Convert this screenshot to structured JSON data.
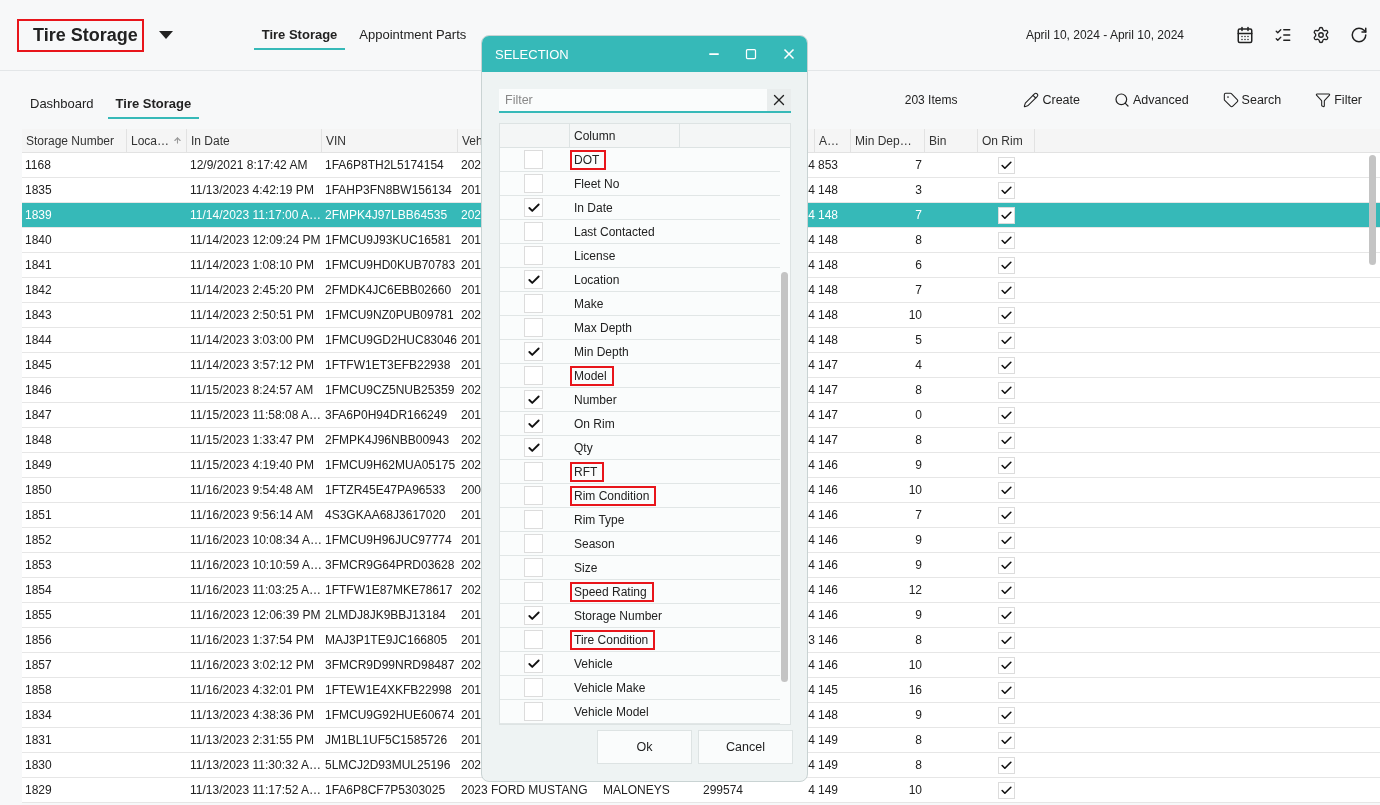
{
  "header": {
    "title": "Tire Storage",
    "title_highlighted": true,
    "nav": [
      {
        "label": "Tire Storage",
        "selected": true
      },
      {
        "label": "Appointment Parts",
        "selected": false
      }
    ],
    "date_range": "April 10, 2024 - April 10, 2024"
  },
  "subnav": {
    "tabs": [
      {
        "label": "Dashboard",
        "selected": false
      },
      {
        "label": "Tire Storage",
        "selected": true
      }
    ],
    "item_count": "203 Items",
    "actions": [
      {
        "label": "Create",
        "kind": "create"
      },
      {
        "label": "Advanced",
        "kind": "advanced"
      },
      {
        "label": "Search",
        "kind": "search"
      },
      {
        "label": "Filter",
        "kind": "filter"
      }
    ]
  },
  "table": {
    "columns": {
      "storage_number": "Storage Number",
      "location": "Loca…",
      "in_date": "In Date",
      "vin": "VIN",
      "vehicle": "Veh",
      "column_9": "A…",
      "min_depth": "Min Dep…",
      "bin": "Bin",
      "on_rim": "On Rim"
    },
    "location_sorted_ascending": true,
    "rows": [
      {
        "storage_number": "1168",
        "in_date": "12/9/2021 8:17:42 AM",
        "vin": "1FA6P8TH2L5174154",
        "vehicle": "202",
        "column_8": "4",
        "column_9": "853",
        "min_depth": "7",
        "on_rim": true,
        "selected": false
      },
      {
        "storage_number": "1835",
        "in_date": "11/13/2023 4:42:19 PM",
        "vin": "1FAHP3FN8BW156134",
        "vehicle": "201",
        "column_8": "4",
        "column_9": "148",
        "min_depth": "3",
        "on_rim": true,
        "selected": false
      },
      {
        "storage_number": "1839",
        "in_date": "11/14/2023 11:17:00 A…",
        "vin": "2FMPK4J97LBB64535",
        "vehicle": "202",
        "column_8": "4",
        "column_9": "148",
        "min_depth": "7",
        "on_rim": true,
        "selected": true
      },
      {
        "storage_number": "1840",
        "in_date": "11/14/2023 12:09:24 PM",
        "vin": "1FMCU9J93KUC16581",
        "vehicle": "201",
        "column_8": "4",
        "column_9": "148",
        "min_depth": "8",
        "on_rim": true,
        "selected": false
      },
      {
        "storage_number": "1841",
        "in_date": "11/14/2023 1:08:10 PM",
        "vin": "1FMCU9HD0KUB70783",
        "vehicle": "201",
        "column_8": "4",
        "column_9": "148",
        "min_depth": "6",
        "on_rim": true,
        "selected": false
      },
      {
        "storage_number": "1842",
        "in_date": "11/14/2023 2:45:20 PM",
        "vin": "2FMDK4JC6EBB02660",
        "vehicle": "201",
        "column_8": "4",
        "column_9": "148",
        "min_depth": "7",
        "on_rim": true,
        "selected": false
      },
      {
        "storage_number": "1843",
        "in_date": "11/14/2023 2:50:51 PM",
        "vin": "1FMCU9NZ0PUB09781",
        "vehicle": "202",
        "column_8": "4",
        "column_9": "148",
        "min_depth": "10",
        "on_rim": true,
        "selected": false
      },
      {
        "storage_number": "1844",
        "in_date": "11/14/2023 3:03:00 PM",
        "vin": "1FMCU9GD2HUC83046",
        "vehicle": "201",
        "column_8": "4",
        "column_9": "148",
        "min_depth": "5",
        "on_rim": true,
        "selected": false
      },
      {
        "storage_number": "1845",
        "in_date": "11/14/2023 3:57:12 PM",
        "vin": "1FTFW1ET3EFB22938",
        "vehicle": "201",
        "column_8": "4",
        "column_9": "147",
        "min_depth": "4",
        "on_rim": true,
        "selected": false
      },
      {
        "storage_number": "1846",
        "in_date": "11/15/2023 8:24:57 AM",
        "vin": "1FMCU9CZ5NUB25359",
        "vehicle": "202",
        "column_8": "4",
        "column_9": "147",
        "min_depth": "8",
        "on_rim": true,
        "selected": false
      },
      {
        "storage_number": "1847",
        "in_date": "11/15/2023 11:58:08 A…",
        "vin": "3FA6P0H94DR166249",
        "vehicle": "201",
        "column_8": "4",
        "column_9": "147",
        "min_depth": "0",
        "on_rim": true,
        "selected": false
      },
      {
        "storage_number": "1848",
        "in_date": "11/15/2023 1:33:47 PM",
        "vin": "2FMPK4J96NBB00943",
        "vehicle": "202",
        "column_8": "4",
        "column_9": "147",
        "min_depth": "8",
        "on_rim": true,
        "selected": false
      },
      {
        "storage_number": "1849",
        "in_date": "11/15/2023 4:19:40 PM",
        "vin": "1FMCU9H62MUA05175",
        "vehicle": "202",
        "column_8": "4",
        "column_9": "146",
        "min_depth": "9",
        "on_rim": true,
        "selected": false
      },
      {
        "storage_number": "1850",
        "in_date": "11/16/2023 9:54:48 AM",
        "vin": "1FTZR45E47PA96533",
        "vehicle": "200",
        "column_8": "4",
        "column_9": "146",
        "min_depth": "10",
        "on_rim": true,
        "selected": false
      },
      {
        "storage_number": "1851",
        "in_date": "11/16/2023 9:56:14 AM",
        "vin": "4S3GKAA68J3617020",
        "vehicle": "201",
        "column_8": "4",
        "column_9": "146",
        "min_depth": "7",
        "on_rim": true,
        "selected": false
      },
      {
        "storage_number": "1852",
        "in_date": "11/16/2023 10:08:34 A…",
        "vin": "1FMCU9H96JUC97774",
        "vehicle": "201",
        "column_8": "4",
        "column_9": "146",
        "min_depth": "9",
        "on_rim": true,
        "selected": false
      },
      {
        "storage_number": "1853",
        "in_date": "11/16/2023 10:10:59 A…",
        "vin": "3FMCR9G64PRD03628",
        "vehicle": "202",
        "column_8": "4",
        "column_9": "146",
        "min_depth": "9",
        "on_rim": true,
        "selected": false
      },
      {
        "storage_number": "1854",
        "in_date": "11/16/2023 11:03:25 A…",
        "vin": "1FTFW1E87MKE78617",
        "vehicle": "202",
        "column_8": "4",
        "column_9": "146",
        "min_depth": "12",
        "on_rim": true,
        "selected": false
      },
      {
        "storage_number": "1855",
        "in_date": "11/16/2023 12:06:39 PM",
        "vin": "2LMDJ8JK9BBJ13184",
        "vehicle": "201",
        "column_8": "4",
        "column_9": "146",
        "min_depth": "9",
        "on_rim": true,
        "selected": false
      },
      {
        "storage_number": "1856",
        "in_date": "11/16/2023 1:37:54 PM",
        "vin": "MAJ3P1TE9JC166805",
        "vehicle": "201",
        "column_8": "3",
        "column_9": "146",
        "min_depth": "8",
        "on_rim": true,
        "selected": false
      },
      {
        "storage_number": "1857",
        "in_date": "11/16/2023 3:02:12 PM",
        "vin": "3FMCR9D99NRD98487",
        "vehicle": "202",
        "column_8": "4",
        "column_9": "146",
        "min_depth": "10",
        "on_rim": true,
        "selected": false
      },
      {
        "storage_number": "1858",
        "in_date": "11/16/2023 4:32:01 PM",
        "vin": "1FTEW1E4XKFB22998",
        "vehicle": "201",
        "column_8": "4",
        "column_9": "145",
        "min_depth": "16",
        "on_rim": true,
        "selected": false
      },
      {
        "storage_number": "1834",
        "in_date": "11/13/2023 4:38:36 PM",
        "vin": "1FMCU9G92HUE60674",
        "vehicle": "201",
        "column_8": "4",
        "column_9": "148",
        "min_depth": "9",
        "on_rim": true,
        "selected": false
      },
      {
        "storage_number": "1831",
        "in_date": "11/13/2023 2:31:55 PM",
        "vin": "JM1BL1UF5C1585726",
        "vehicle": "201",
        "column_8": "4",
        "column_9": "149",
        "min_depth": "8",
        "on_rim": true,
        "selected": false
      },
      {
        "storage_number": "1830",
        "in_date": "11/13/2023 11:30:32 A…",
        "vin": "5LMCJ2D93MUL25196",
        "vehicle": "202",
        "column_8": "4",
        "column_9": "149",
        "min_depth": "8",
        "on_rim": true,
        "selected": false
      },
      {
        "storage_number": "1829",
        "in_date": "11/13/2023 11:17:52 A…",
        "vin": "1FA6P8CF7P5303025",
        "vehicle": "2023 FORD MUSTANG",
        "column_6": "MALONEYS",
        "column_7": "299574",
        "column_8": "4",
        "column_9": "149",
        "min_depth": "10",
        "on_rim": true,
        "selected": false
      }
    ]
  },
  "dialog": {
    "title": "SELECTION",
    "filter": {
      "placeholder": "Filter"
    },
    "list_header": "Column",
    "items": [
      {
        "label": "DOT",
        "checked": false,
        "highlighted": true
      },
      {
        "label": "Fleet No",
        "checked": false,
        "highlighted": false
      },
      {
        "label": "In Date",
        "checked": true,
        "highlighted": false
      },
      {
        "label": "Last Contacted",
        "checked": false,
        "highlighted": false
      },
      {
        "label": "License",
        "checked": false,
        "highlighted": false
      },
      {
        "label": "Location",
        "checked": true,
        "highlighted": false
      },
      {
        "label": "Make",
        "checked": false,
        "highlighted": false
      },
      {
        "label": "Max Depth",
        "checked": false,
        "highlighted": false
      },
      {
        "label": "Min Depth",
        "checked": true,
        "highlighted": false
      },
      {
        "label": "Model",
        "checked": false,
        "highlighted": true
      },
      {
        "label": "Number",
        "checked": true,
        "highlighted": false
      },
      {
        "label": "On Rim",
        "checked": true,
        "highlighted": false
      },
      {
        "label": "Qty",
        "checked": true,
        "highlighted": false
      },
      {
        "label": "RFT",
        "checked": false,
        "highlighted": true
      },
      {
        "label": "Rim Condition",
        "checked": false,
        "highlighted": true
      },
      {
        "label": "Rim Type",
        "checked": false,
        "highlighted": false
      },
      {
        "label": "Season",
        "checked": false,
        "highlighted": false
      },
      {
        "label": "Size",
        "checked": false,
        "highlighted": false
      },
      {
        "label": "Speed Rating",
        "checked": false,
        "highlighted": true
      },
      {
        "label": "Storage Number",
        "checked": true,
        "highlighted": false
      },
      {
        "label": "Tire Condition",
        "checked": false,
        "highlighted": true
      },
      {
        "label": "Vehicle",
        "checked": true,
        "highlighted": false
      },
      {
        "label": "Vehicle Make",
        "checked": false,
        "highlighted": false
      },
      {
        "label": "Vehicle Model",
        "checked": false,
        "highlighted": false
      }
    ],
    "buttons": [
      "Ok",
      "Cancel"
    ]
  }
}
